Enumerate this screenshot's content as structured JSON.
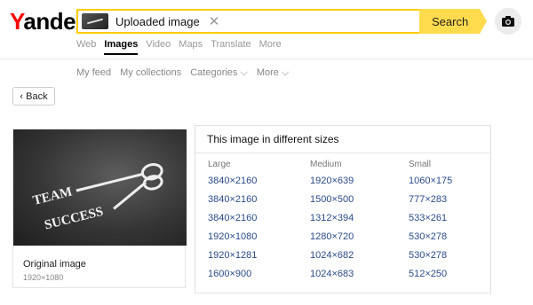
{
  "header": {
    "logo_first": "Y",
    "logo_rest": "andex",
    "search_chip_label": "Uploaded image",
    "clear_symbol": "✕",
    "search_button": "Search",
    "camera_icon": "camera-icon"
  },
  "services": [
    "Web",
    "Images",
    "Video",
    "Maps",
    "Translate",
    "More"
  ],
  "active_service": "Images",
  "subnav": [
    "My feed",
    "My collections",
    "Categories ⌵",
    "More ⌵"
  ],
  "back_label": "‹ Back",
  "original": {
    "title": "Original image",
    "size": "1920×1080",
    "image_text_1": "TEAM",
    "image_text_2": "SUCCESS"
  },
  "sizes": {
    "title": "This image in different sizes",
    "columns": [
      {
        "label": "Large",
        "items": [
          "3840×2160",
          "3840×2160",
          "3840×2160",
          "1920×1080",
          "1920×1281",
          "1600×900"
        ]
      },
      {
        "label": "Medium",
        "items": [
          "1920×639",
          "1500×500",
          "1312×394",
          "1280×720",
          "1024×682",
          "1024×683"
        ]
      },
      {
        "label": "Small",
        "items": [
          "1060×175",
          "777×283",
          "533×261",
          "530×278",
          "530×278",
          "512×250"
        ]
      }
    ]
  },
  "colors": {
    "accent": "#ffdb4d",
    "link": "#2a4b8a",
    "brand_red": "#ff0000"
  }
}
